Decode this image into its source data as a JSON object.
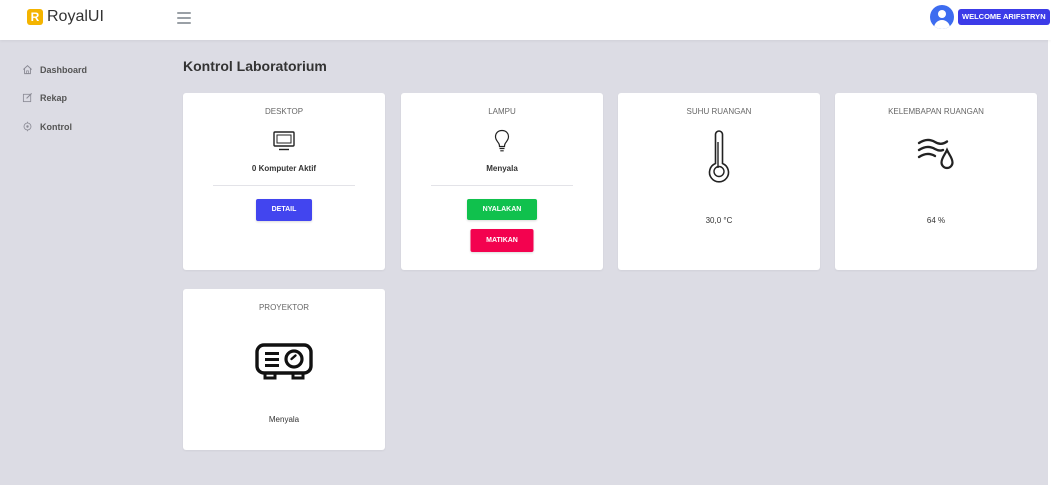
{
  "brand": {
    "logo_letter": "R",
    "name": "RoyalUI"
  },
  "header": {
    "welcome_label": "WELCOME ARIFSTRYN"
  },
  "sidebar": {
    "items": [
      {
        "label": "Dashboard",
        "icon": "home-icon"
      },
      {
        "label": "Rekap",
        "icon": "edit-icon"
      },
      {
        "label": "Kontrol",
        "icon": "control-icon"
      }
    ]
  },
  "main": {
    "title": "Kontrol Laboratorium",
    "cards": {
      "desktop": {
        "title": "DESKTOP",
        "status": "0 Komputer Aktif",
        "button": "DETAIL"
      },
      "lampu": {
        "title": "LAMPU",
        "status": "Menyala",
        "button_on": "NYALAKAN",
        "button_off": "MATIKAN"
      },
      "suhu": {
        "title": "SUHU RUANGAN",
        "value": "30,0 °C"
      },
      "kelembapan": {
        "title": "KELEMBAPAN RUANGAN",
        "value": "64 %"
      },
      "proyektor": {
        "title": "PROYEKTOR",
        "status": "Menyala"
      }
    }
  },
  "colors": {
    "primary": "#3c3be8",
    "detail_button": "#4245ef",
    "success": "#10c14d",
    "danger": "#f3024f",
    "background": "#dcdce4",
    "brand": "#f4b400"
  }
}
